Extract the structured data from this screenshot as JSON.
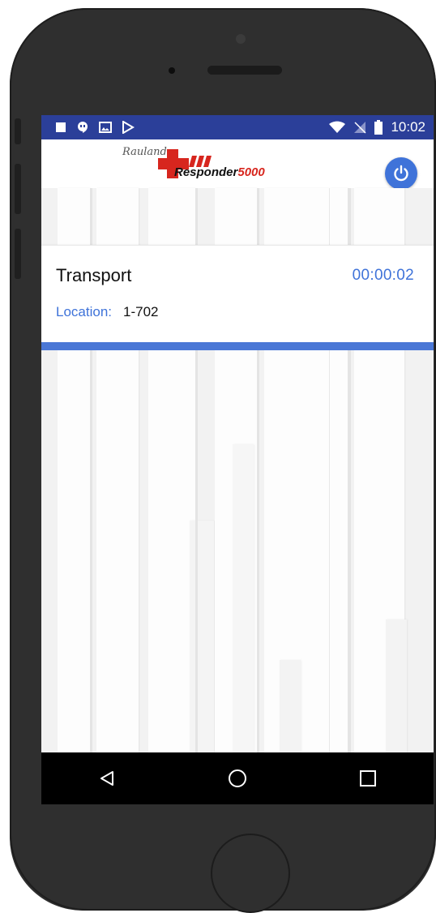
{
  "status_bar": {
    "time": "10:02",
    "left_icons": [
      "stop-icon",
      "hangouts-icon",
      "image-icon",
      "play-store-icon"
    ],
    "right_icons": [
      "wifi-icon",
      "no-signal-icon",
      "battery-icon"
    ]
  },
  "app_bar": {
    "logo": {
      "script": "Rauland",
      "product": "Responder",
      "number": "5000"
    },
    "power_icon": "power-icon"
  },
  "card": {
    "title": "Transport",
    "timer": "00:00:02",
    "location_label": "Location:",
    "location_value": "1-702"
  },
  "nav_bar": {
    "icons": [
      "back-icon",
      "home-icon",
      "recents-icon"
    ]
  },
  "colors": {
    "status_bar": "#2b3f99",
    "accent": "#3f73d9",
    "logo_red": "#d7261e"
  }
}
